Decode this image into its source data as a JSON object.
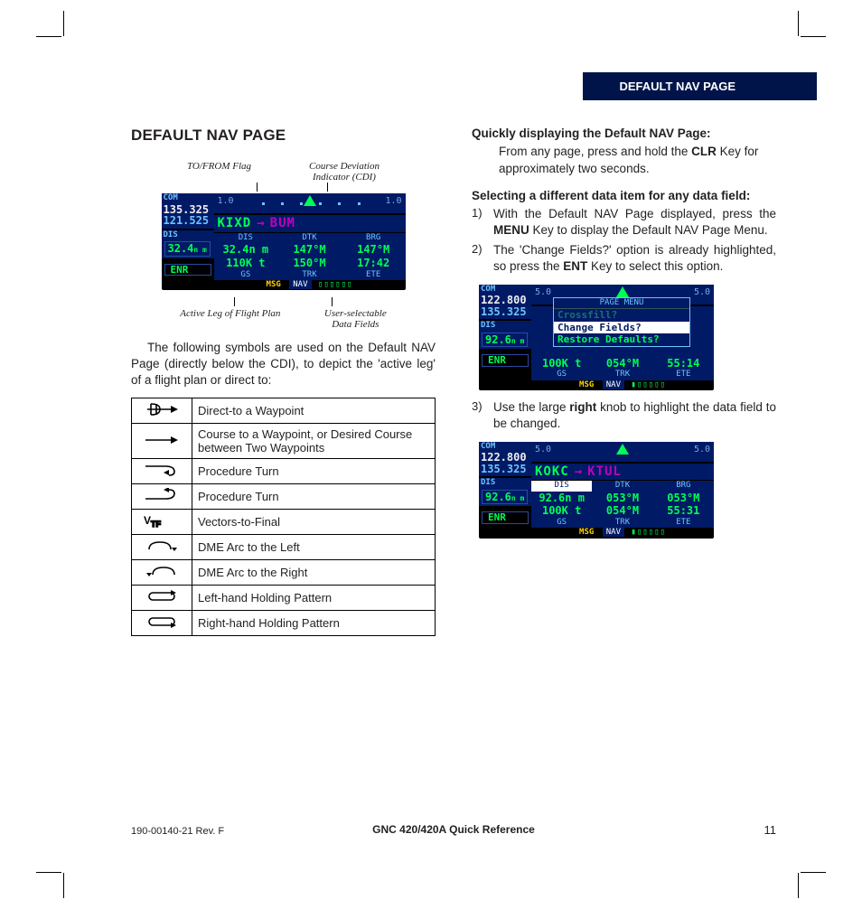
{
  "header": {
    "tab": "DEFAULT NAV PAGE"
  },
  "left": {
    "title": "DEFAULT NAV PAGE",
    "callouts": {
      "top_left": "TO/FROM Flag",
      "top_right_a": "Course Deviation",
      "top_right_b": "Indicator (CDI)",
      "bot_left": "Active Leg of Flight Plan",
      "bot_right_a": "User-selectable",
      "bot_right_b": "Data Fields"
    },
    "device1": {
      "com_label": "COM",
      "com_active": "135.325",
      "com_standby": "121.525",
      "dis_label": "DIS",
      "dis_value": "32.4",
      "dis_unit": "n m",
      "enr": "ENR",
      "cdi_left": "1.0",
      "cdi_right": "1.0",
      "wpt_from": "KIXD",
      "wpt_to": "BUM",
      "heads": [
        "DIS",
        "DTK",
        "BRG"
      ],
      "row1": [
        "32.4n m",
        "147°M",
        "147°M"
      ],
      "row2": [
        "110K t",
        "150°M",
        "17:42"
      ],
      "foot": [
        "GS",
        "TRK",
        "ETE"
      ],
      "msg": "MSG",
      "nav": "NAV",
      "boxes": "▯▯▯▯▯▯"
    },
    "para1": "The following symbols are used on the Default NAV Page (directly below the CDI), to depict the 'active leg' of a flight plan or direct to:",
    "table": [
      {
        "kind": "directto",
        "label": "Direct-to a Waypoint"
      },
      {
        "kind": "course",
        "label": "Course to a Waypoint, or Desired Course between Two Waypoints"
      },
      {
        "kind": "pturn_r",
        "label": "Procedure Turn"
      },
      {
        "kind": "pturn_l",
        "label": "Procedure Turn"
      },
      {
        "kind": "vtf",
        "label": "Vectors-to-Final"
      },
      {
        "kind": "dme_left",
        "label": "DME Arc to the Left"
      },
      {
        "kind": "dme_right",
        "label": "DME Arc to the Right"
      },
      {
        "kind": "hold_left",
        "label": "Left-hand Holding Pattern"
      },
      {
        "kind": "hold_right",
        "label": "Right-hand Holding Pattern"
      }
    ]
  },
  "right": {
    "sub1": "Quickly displaying the Default NAV Page:",
    "sub1_body_a": "From any page, press and hold the ",
    "sub1_body_bold": "CLR",
    "sub1_body_b": " Key for approximately two seconds.",
    "sub2": "Selecting a different data item for any data field:",
    "steps12": [
      {
        "num": "1)",
        "a": "With the Default NAV Page displayed, press the ",
        "bold": "MENU",
        "b": " Key to display the Default NAV Page Menu."
      },
      {
        "num": "2)",
        "a": "The 'Change Fields?' option is already highlighted, so press the ",
        "bold": "ENT",
        "b": " Key to select this option."
      }
    ],
    "device2": {
      "com_label": "COM",
      "com_active": "122.800",
      "com_standby": "135.325",
      "dis_label": "DIS",
      "dis_value": "92.6",
      "dis_unit": "n m",
      "enr": "ENR",
      "cdi_left": "5.0",
      "cdi_right": "5.0",
      "menu_title": "PAGE MENU",
      "menu_items": [
        "Crossfill?",
        "Change Fields?",
        "Restore Defaults?"
      ],
      "row2": [
        "100K t",
        "054°M",
        "55:14"
      ],
      "foot": [
        "GS",
        "TRK",
        "ETE"
      ],
      "msg": "MSG",
      "nav": "NAV",
      "boxes": "▮▯▯▯▯▯"
    },
    "step3": {
      "num": "3)",
      "a": "Use the large ",
      "bold": "right",
      "b": " knob to highlight the data field to be changed."
    },
    "device3": {
      "com_label": "COM",
      "com_active": "122.800",
      "com_standby": "135.325",
      "dis_label": "DIS",
      "dis_value": "92.6",
      "dis_unit": "n m",
      "enr": "ENR",
      "cdi_left": "5.0",
      "cdi_right": "5.0",
      "wpt_from": "KOKC",
      "wpt_to": "KTUL",
      "heads": [
        "DIS",
        "DTK",
        "BRG"
      ],
      "row1": [
        "92.6n m",
        "053°M",
        "053°M"
      ],
      "row2": [
        "100K t",
        "054°M",
        "55:31"
      ],
      "foot": [
        "GS",
        "TRK",
        "ETE"
      ],
      "msg": "MSG",
      "nav": "NAV",
      "boxes": "▮▯▯▯▯▯"
    }
  },
  "footer": {
    "left": "190-00140-21  Rev. F",
    "center": "GNC 420/420A Quick Reference",
    "right": "11"
  }
}
